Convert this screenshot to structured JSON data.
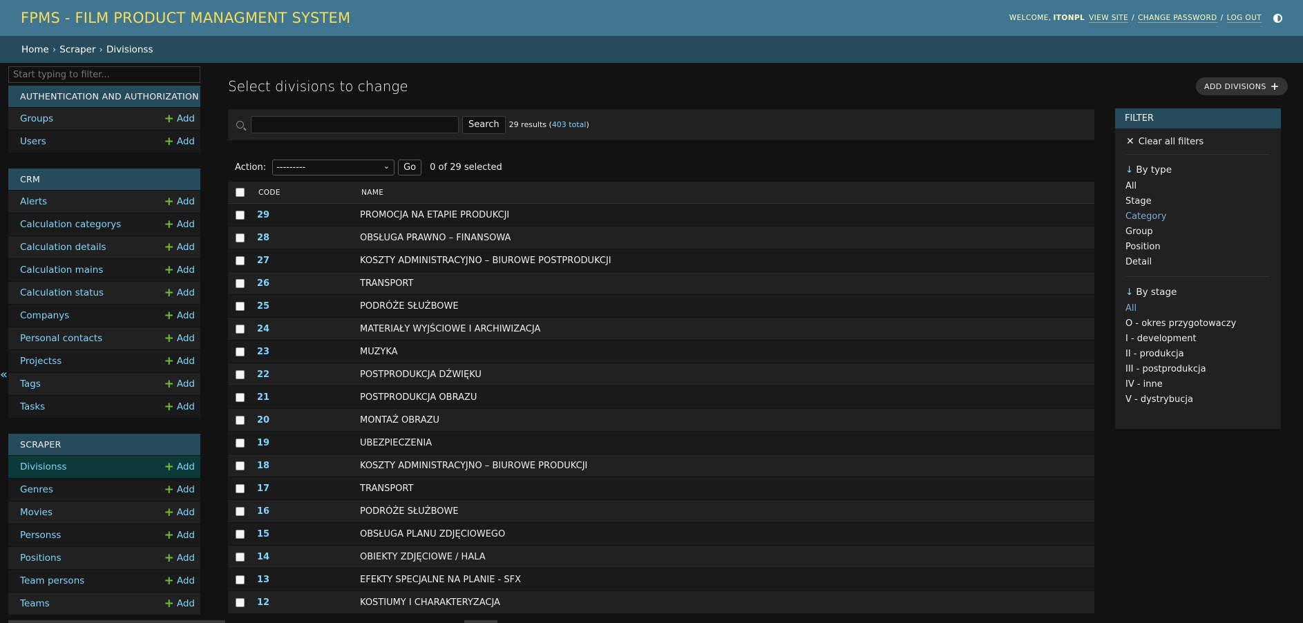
{
  "header": {
    "brand": "FPMS - FILM PRODUCT MANAGMENT SYSTEM",
    "welcome": "WELCOME,",
    "username": "ITONPL",
    "view_site": "VIEW SITE",
    "change_password": "CHANGE PASSWORD",
    "log_out": "LOG OUT",
    "separator": "/"
  },
  "breadcrumbs": [
    "Home",
    "Scraper",
    "Divisionss"
  ],
  "sidebar": {
    "filter_placeholder": "Start typing to filter...",
    "add_label": "Add",
    "modules": [
      {
        "caption": "AUTHENTICATION AND AUTHORIZATION",
        "items": [
          "Groups",
          "Users"
        ]
      },
      {
        "caption": "CRM",
        "items": [
          "Alerts",
          "Calculation categorys",
          "Calculation details",
          "Calculation mains",
          "Calculation status",
          "Companys",
          "Personal contacts",
          "Projectss",
          "Tags",
          "Tasks"
        ]
      },
      {
        "caption": "SCRAPER",
        "items": [
          "Divisionss",
          "Genres",
          "Movies",
          "Personss",
          "Positions",
          "Team persons",
          "Teams"
        ]
      }
    ]
  },
  "main": {
    "title": "Select divisions to change",
    "add_button": "ADD DIVISIONS",
    "search_button": "Search",
    "results_text": "29 results (",
    "results_total": "403 total",
    "results_close": ")",
    "action_label": "Action:",
    "action_value": "---------",
    "go_button": "Go",
    "selected_count": "0 of 29 selected",
    "columns": [
      "CODE",
      "NAME"
    ],
    "rows": [
      {
        "code": "29",
        "name": "PROMOCJA NA ETAPIE PRODUKCJI"
      },
      {
        "code": "28",
        "name": "OBSŁUGA PRAWNO – FINANSOWA"
      },
      {
        "code": "27",
        "name": "KOSZTY ADMINISTRACYJNO – BIUROWE POSTPRODUKCJI"
      },
      {
        "code": "26",
        "name": "TRANSPORT"
      },
      {
        "code": "25",
        "name": "PODRÓŻE SŁUŻBOWE"
      },
      {
        "code": "24",
        "name": "MATERIAŁY WYJŚCIOWE I ARCHIWIZACJA"
      },
      {
        "code": "23",
        "name": "MUZYKA"
      },
      {
        "code": "22",
        "name": "POSTPRODUKCJA DŹWIĘKU"
      },
      {
        "code": "21",
        "name": "POSTPRODUKCJA OBRAZU"
      },
      {
        "code": "20",
        "name": "MONTAŻ OBRAZU"
      },
      {
        "code": "19",
        "name": "UBEZPIECZENIA"
      },
      {
        "code": "18",
        "name": "KOSZTY ADMINISTRACYJNO – BIUROWE PRODUKCJI"
      },
      {
        "code": "17",
        "name": "TRANSPORT"
      },
      {
        "code": "16",
        "name": "PODRÓŻE SŁUŻBOWE"
      },
      {
        "code": "15",
        "name": "OBSŁUGA PLANU ZDJĘCIOWEGO"
      },
      {
        "code": "14",
        "name": "OBIEKTY ZDJĘCIOWE / HALA"
      },
      {
        "code": "13",
        "name": "EFEKTY SPECJALNE NA PLANIE - SFX"
      },
      {
        "code": "12",
        "name": "KOSTIUMY I CHARAKTERYZACJA"
      }
    ]
  },
  "filter": {
    "caption": "FILTER",
    "clear_all": "Clear all filters",
    "groups": [
      {
        "title": "By type",
        "options": [
          "All",
          "Stage",
          "Category",
          "Group",
          "Position",
          "Detail"
        ],
        "selected": "Category"
      },
      {
        "title": "By stage",
        "options": [
          "All",
          "O - okres przygotowaczy",
          "I - development",
          "II - produkcja",
          "III - postprodukcja",
          "IV - inne",
          "V - dystrybucja"
        ],
        "selected": "All"
      }
    ]
  },
  "colors": {
    "header_bg": "#417690",
    "breadcrumb_bg": "#264b5d",
    "brand": "#f5dd5d",
    "link": "#81d4fa",
    "add_plus": "#70bf2b"
  }
}
